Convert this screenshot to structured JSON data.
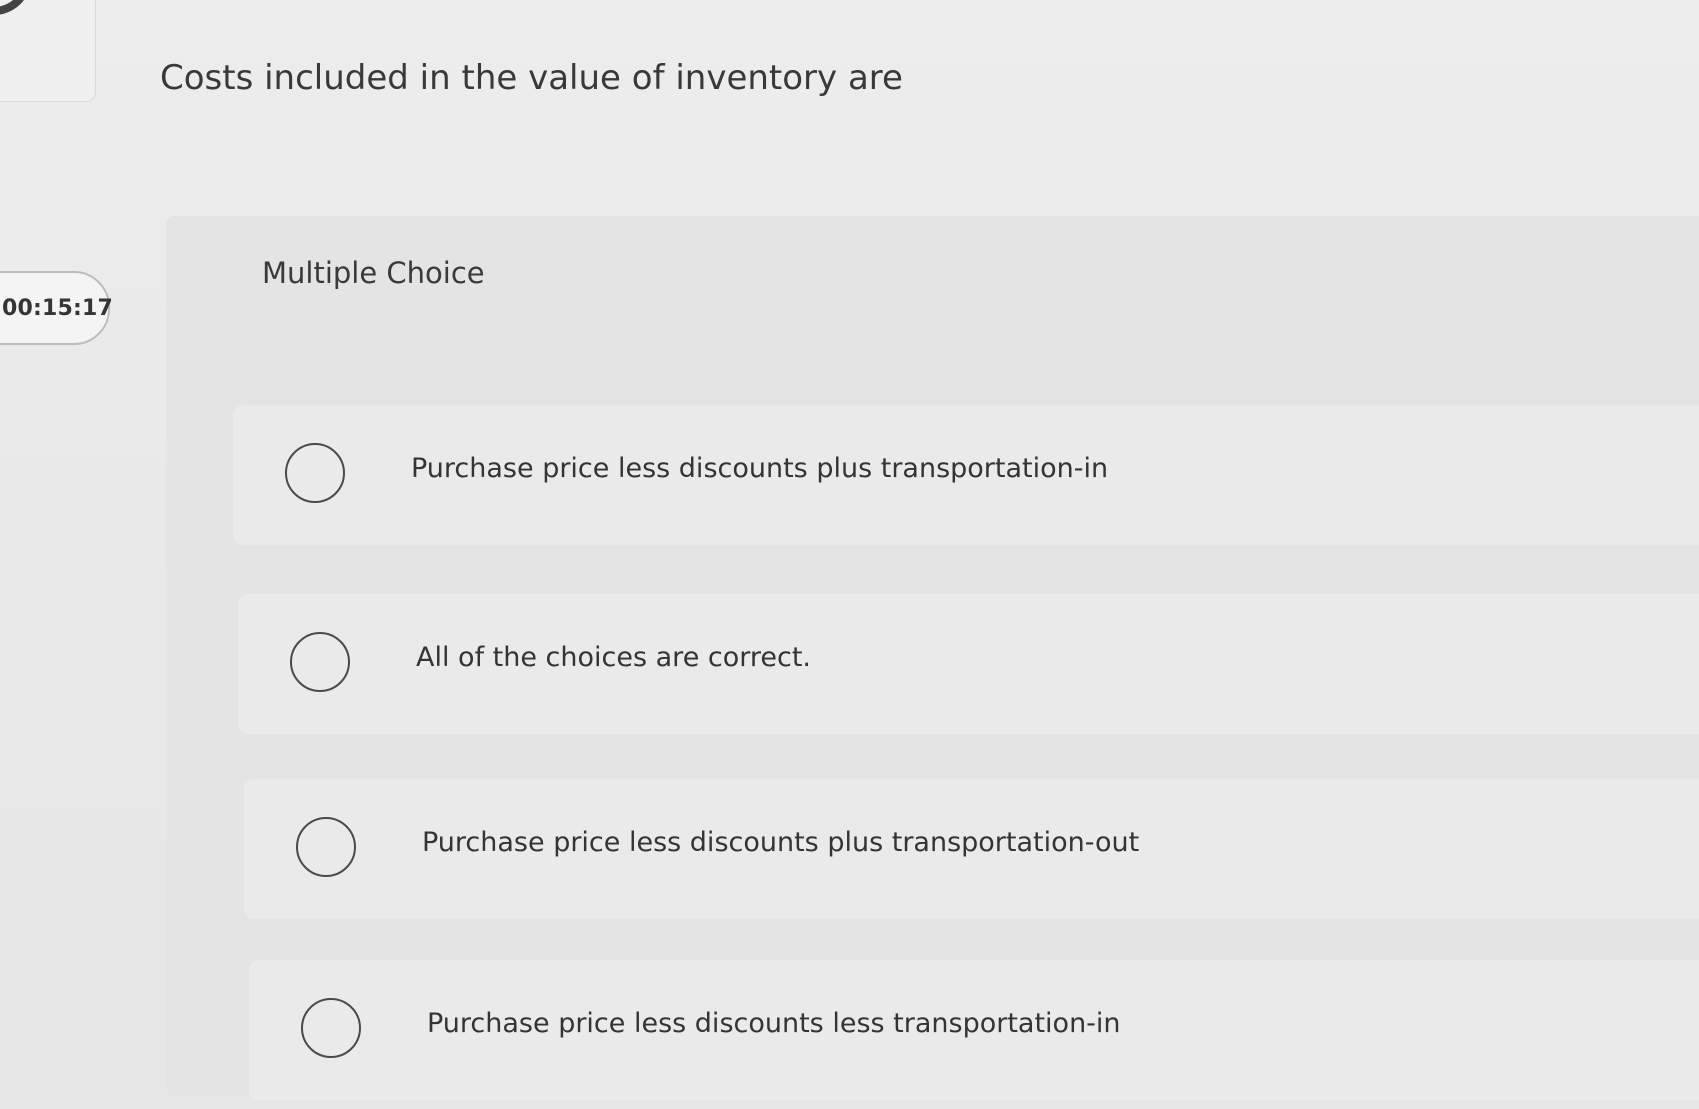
{
  "question": {
    "text": "Costs included in the value of inventory are"
  },
  "timer": {
    "value": "00:15:17"
  },
  "quiz": {
    "type_label": "Multiple Choice",
    "options": [
      {
        "label": "Purchase price less discounts plus transportation-in"
      },
      {
        "label": "All of the choices are correct."
      },
      {
        "label": "Purchase price less discounts plus transportation-out"
      },
      {
        "label": "Purchase price less discounts less transportation-in"
      }
    ]
  }
}
